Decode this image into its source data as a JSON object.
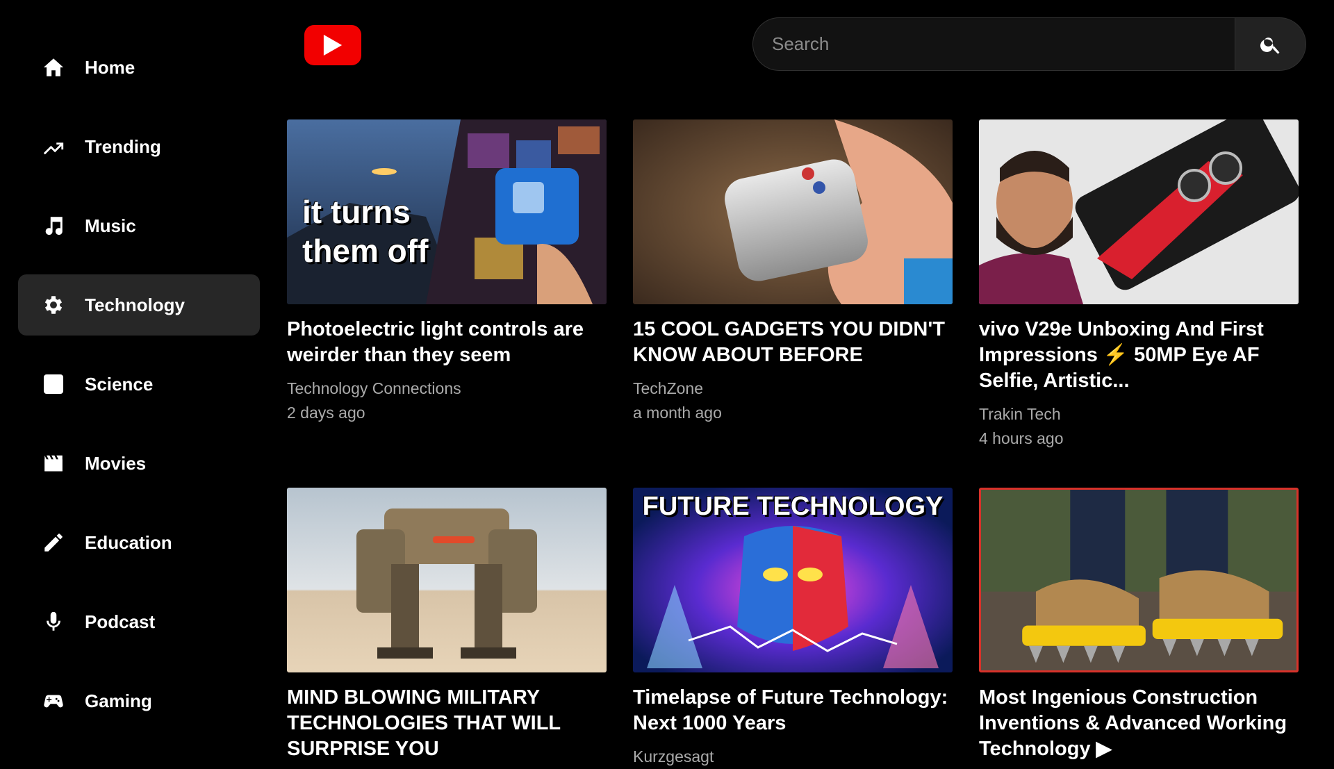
{
  "sidebar": {
    "items": [
      {
        "label": "Home",
        "icon": "home-icon"
      },
      {
        "label": "Trending",
        "icon": "trending-icon"
      },
      {
        "label": "Music",
        "icon": "music-note-icon"
      },
      {
        "label": "Technology",
        "icon": "gear-icon",
        "active": true
      },
      {
        "label": "Science",
        "icon": "atom-icon"
      },
      {
        "label": "Movies",
        "icon": "clapperboard-icon"
      },
      {
        "label": "Education",
        "icon": "pencil-icon"
      },
      {
        "label": "Podcast",
        "icon": "microphone-icon"
      },
      {
        "label": "Gaming",
        "icon": "gamepad-icon"
      }
    ]
  },
  "header": {
    "logo": "youtube-logo-icon",
    "search": {
      "placeholder": "Search",
      "value": ""
    },
    "search_button_icon": "search-icon"
  },
  "videos": [
    {
      "title": "Photoelectric light controls are weirder than they seem",
      "channel": "Technology Connections",
      "time": "2 days ago",
      "thumb_text": [
        "it turns",
        "them off"
      ]
    },
    {
      "title": "15 COOL GADGETS YOU DIDN'T KNOW ABOUT BEFORE",
      "channel": "TechZone",
      "time": "a month ago"
    },
    {
      "title": "vivo V29e Unboxing And First Impressions ⚡ 50MP Eye AF Selfie, Artistic...",
      "channel": "Trakin Tech",
      "time": "4 hours ago"
    },
    {
      "title": "MIND BLOWING MILITARY TECHNOLOGIES THAT WILL SURPRISE YOU",
      "channel": "",
      "time": ""
    },
    {
      "title": "Timelapse of Future Technology: Next 1000 Years",
      "channel": "Kurzgesagt",
      "time": "",
      "thumb_text": [
        "FUTURE TECHNOLOGY"
      ]
    },
    {
      "title": "Most Ingenious Construction Inventions & Advanced Working Technology ▶",
      "channel": "",
      "time": ""
    }
  ],
  "colors": {
    "background": "#000000",
    "sidebar_active": "#272727",
    "logo_red": "#f20000",
    "secondary_text": "#aaaaaa"
  }
}
